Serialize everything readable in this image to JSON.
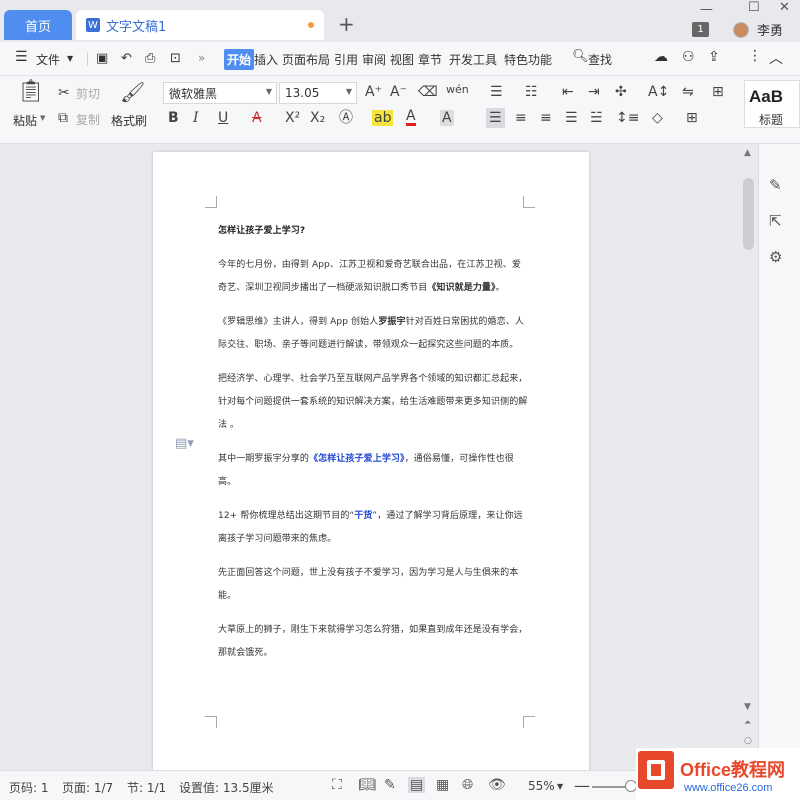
{
  "tabs": {
    "home": "首页",
    "doc_icon": "W",
    "doc": "文字文稿1",
    "new_tab": "+"
  },
  "user": {
    "badge": "1",
    "name": "李勇"
  },
  "menubar": {
    "file": "文件",
    "items": [
      "开始",
      "插入",
      "页面布局",
      "引用",
      "审阅",
      "视图",
      "章节",
      "开发工具",
      "特色功能"
    ],
    "search": "查找"
  },
  "toolbar": {
    "paste": "粘贴",
    "cut": "剪切",
    "copy": "复制",
    "format_painter": "格式刷",
    "font_name": "微软雅黑",
    "font_size": "13.05",
    "style_preview": "AaB",
    "style_label": "标题"
  },
  "document": {
    "title": "怎样让孩子爱上学习?",
    "p1": "今年的七月份，由得到 App、江苏卫视和爱奇艺联合出品，在江苏卫视、爱奇艺、深圳卫视同步播出了一档硬派知识脱口秀节目",
    "p1_bold": "《知识就是力量》",
    "p1_end": "。",
    "p2_a": "《罗辑思维》主讲人，得到 App 创始人",
    "p2_bold": "罗振宇",
    "p2_b": "针对百姓日常困扰的婚恋、人际交往、职场、亲子等问题进行解读，带领观众一起探究这些问题的本质。",
    "p3": "把经济学、心理学、社会学乃至互联网产品学界各个领域的知识都汇总起来，针对每个问题提供一套系统的知识解决方案，给生活难题带来更多知识侧的解法 。",
    "p4_a": "其中一期罗振宇分享的",
    "p4_blue": "《怎样让孩子爱上学习》",
    "p4_b": "，通俗易懂，可操作性也很高。",
    "p5_a": "12+ 帮你梳理总结出这期节目的“",
    "p5_blue": "干货",
    "p5_b": "”，通过了解学习背后原理，来让你远离孩子学习问题带来的焦虑。",
    "p6": "先正面回答这个问题，世上没有孩子不爱学习，因为学习是人与生俱来的本能。",
    "p7": "大草原上的狮子，刚生下来就得学习怎么狩猎，如果直到成年还是没有学会，那就会饿死。"
  },
  "status": {
    "page_no": "页码: 1",
    "pages": "页面: 1/7",
    "section": "节: 1/1",
    "setting": "设置值: 13.5厘米",
    "zoom": "55%"
  },
  "watermark": {
    "title": "Office教程网",
    "url": "www.office26.com"
  },
  "icons": [
    "hamburger-icon",
    "save-icon",
    "undo-icon",
    "print-icon",
    "preview-icon",
    "search-icon",
    "cloud-icon",
    "share-icon",
    "export-icon",
    "more-icon",
    "collapse-icon",
    "bold-icon",
    "italic-icon",
    "underline-icon",
    "strikethrough-icon",
    "superscript-icon",
    "subscript-icon",
    "highlight-icon",
    "font-color-icon",
    "align-left-icon",
    "align-center-icon",
    "align-right-icon",
    "justify-icon",
    "pen-icon",
    "cursor-icon",
    "settings-icon",
    "grid-icon",
    "fullscreen-icon",
    "read-icon",
    "edit-icon",
    "page-view-icon",
    "outline-icon",
    "web-icon",
    "eye-icon"
  ],
  "colors": {
    "accent": "#4f8ef0",
    "tab_text": "#3a6fd8",
    "link_blue": "#2148d6",
    "logo_red": "#e8482a"
  }
}
